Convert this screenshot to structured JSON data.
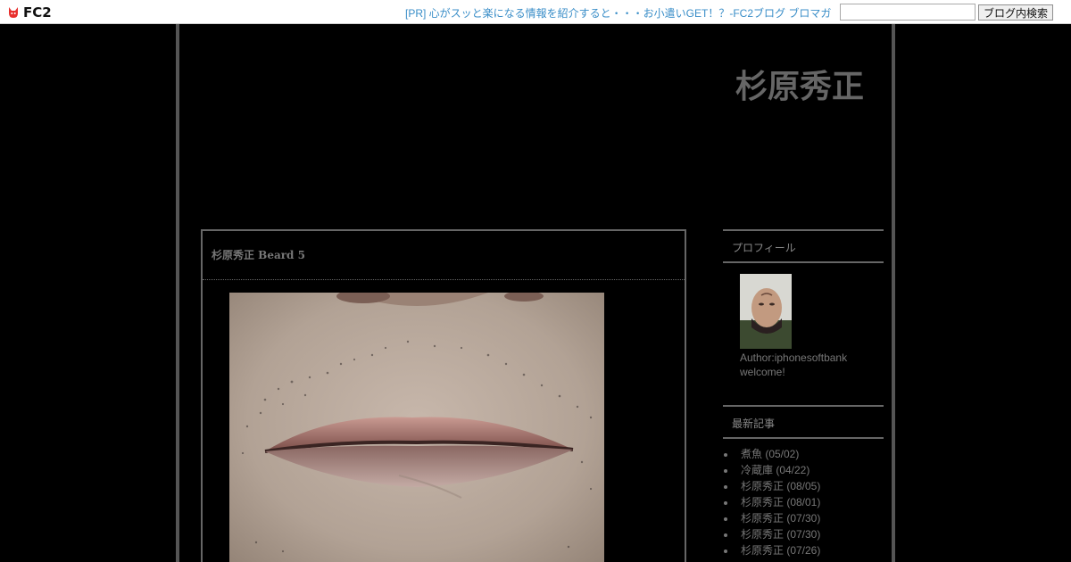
{
  "fc2_bar": {
    "logo_text": "FC2",
    "pr_link": "[PR] 心がスッと楽になる情報を紹介すると・・・お小遣いGET！？-FC2ブログ ブロマガ",
    "search_value": "",
    "search_button": "ブログ内検索"
  },
  "blog": {
    "title": "杉原秀正"
  },
  "entry": {
    "title": "杉原秀正 Beard 5"
  },
  "sidebar": {
    "profile": {
      "heading": "プロフィール",
      "author": "Author:iphonesoftbank",
      "message": "welcome!"
    },
    "recent": {
      "heading": "最新記事",
      "items": [
        "煮魚 (05/02)",
        "冷蔵庫 (04/22)",
        "杉原秀正 (08/05)",
        "杉原秀正 (08/01)",
        "杉原秀正 (07/30)",
        "杉原秀正 (07/30)",
        "杉原秀正 (07/26)"
      ]
    }
  },
  "colors": {
    "link": "#3a8ec8",
    "frame": "#555555",
    "background": "#000000"
  }
}
